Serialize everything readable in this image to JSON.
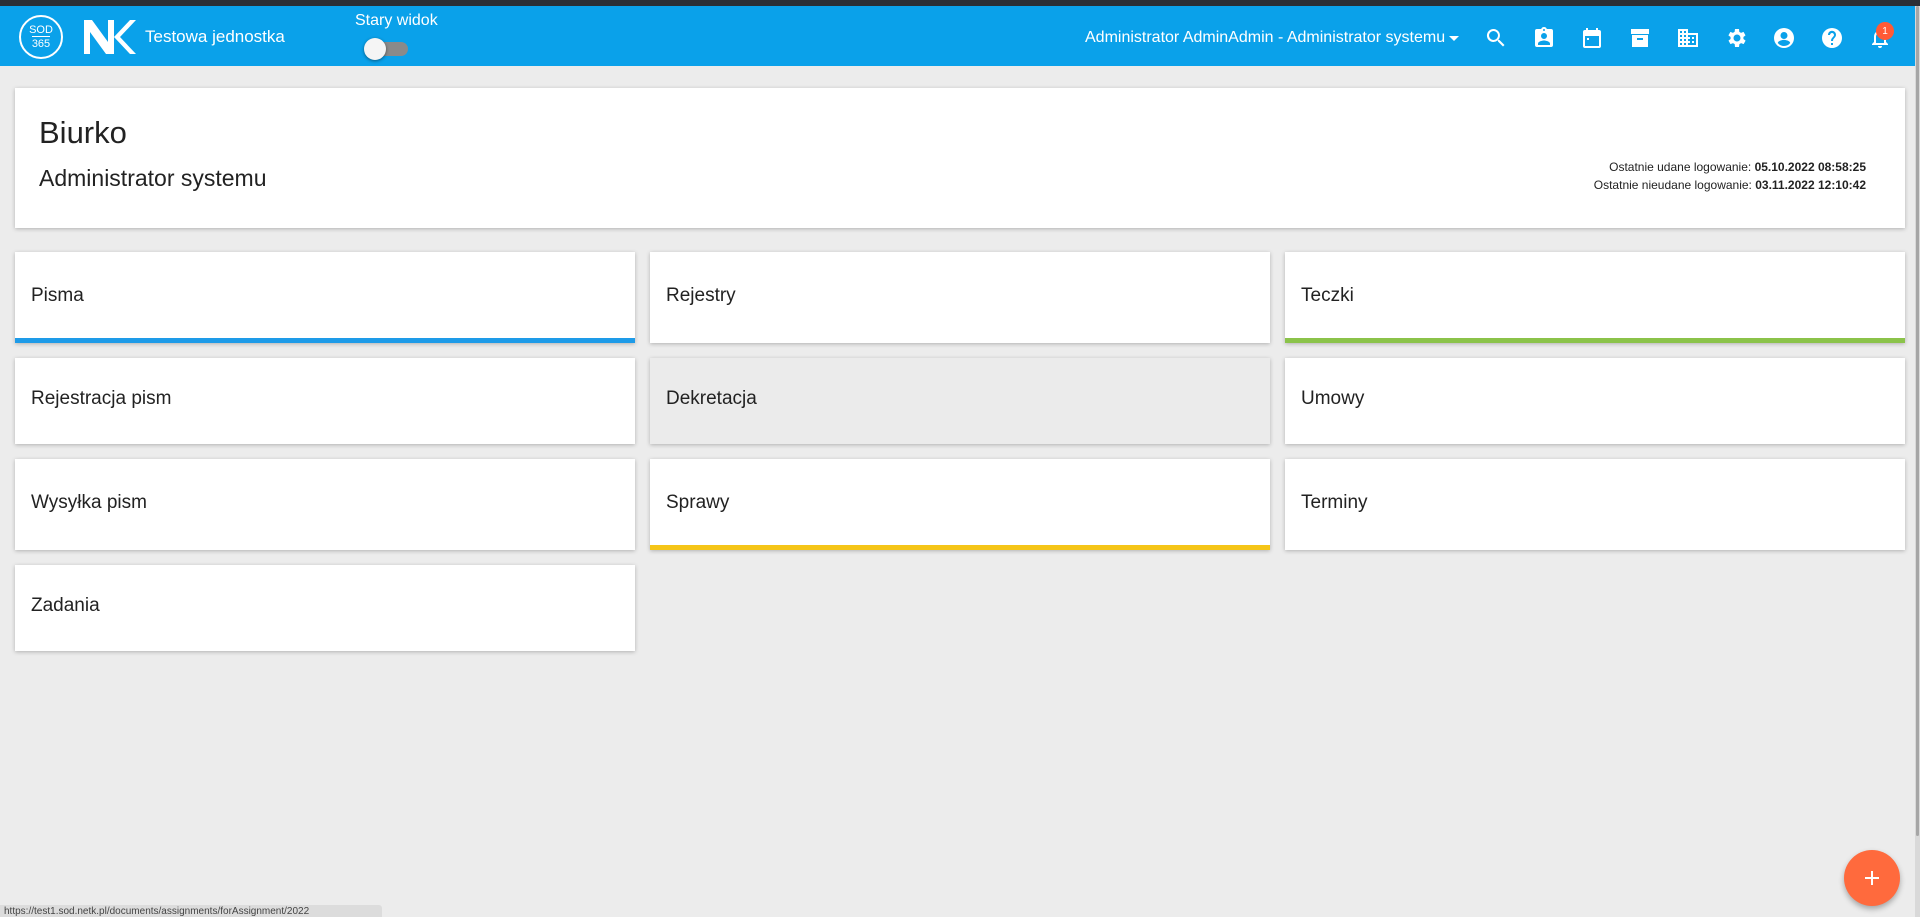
{
  "appbar": {
    "logo_line1": "SOD",
    "logo_line2": "365",
    "unit_name": "Testowa jednostka",
    "old_view_label": "Stary widok",
    "user_menu_label": "Administrator AdminAdmin - Administrator systemu",
    "notifications_count": "1",
    "icons": [
      "search-icon",
      "contact-card-icon",
      "calendar-icon",
      "archive-icon",
      "building-icon",
      "gear-icon",
      "account-icon",
      "help-icon",
      "bell-icon"
    ],
    "colors": {
      "bar": "#0aa1ea",
      "badge": "#ff5a36"
    }
  },
  "header": {
    "title": "Biurko",
    "subtitle": "Administrator systemu",
    "last_success_label": "Ostatnie udane logowanie:",
    "last_success_value": "05.10.2022 08:58:25",
    "last_failed_label": "Ostatnie nieudane logowanie:",
    "last_failed_value": "03.11.2022 12:10:42"
  },
  "tiles": [
    {
      "label": "Pisma",
      "accent": "#1e9be8"
    },
    {
      "label": "Rejestry",
      "accent": ""
    },
    {
      "label": "Teczki",
      "accent": "#8bc34a"
    },
    {
      "label": "Rejestracja pism",
      "accent": ""
    },
    {
      "label": "Dekretacja",
      "accent": ""
    },
    {
      "label": "Umowy",
      "accent": ""
    },
    {
      "label": "Wysyłka pism",
      "accent": ""
    },
    {
      "label": "Sprawy",
      "accent": "#f5c518"
    },
    {
      "label": "Terminy",
      "accent": ""
    },
    {
      "label": "Zadania",
      "accent": ""
    }
  ],
  "status_bar": {
    "url": "https://test1.sod.netk.pl/documents/assignments/forAssignment/2022"
  },
  "fab": {
    "icon": "plus-icon",
    "color": "#ff6a3d"
  }
}
